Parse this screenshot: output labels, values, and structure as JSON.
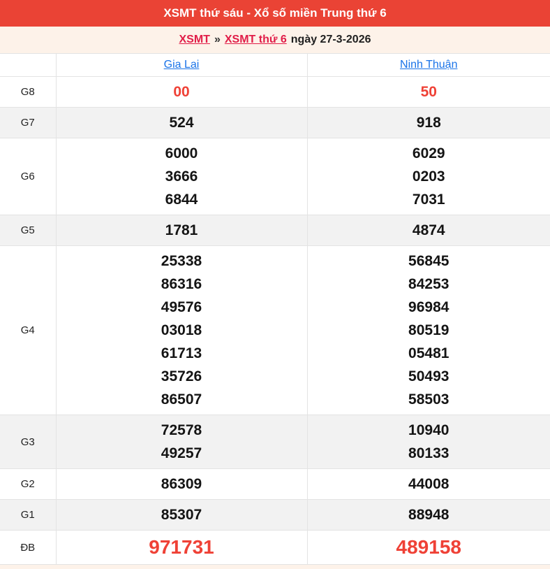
{
  "header": {
    "title": "XSMT thứ sáu - Xổ số miền Trung thứ 6"
  },
  "breadcrumb": {
    "link1": "XSMT",
    "separator": "»",
    "link2": "XSMT thứ 6",
    "suffix": "ngày 27-3-2026"
  },
  "columns": [
    "Gia Lai",
    "Ninh Thuận"
  ],
  "rows": [
    {
      "label": "G8",
      "highlight": true,
      "shaded": false,
      "big": false,
      "cells": [
        [
          "00"
        ],
        [
          "50"
        ]
      ]
    },
    {
      "label": "G7",
      "highlight": false,
      "shaded": true,
      "big": false,
      "cells": [
        [
          "524"
        ],
        [
          "918"
        ]
      ]
    },
    {
      "label": "G6",
      "highlight": false,
      "shaded": false,
      "big": false,
      "cells": [
        [
          "6000",
          "3666",
          "6844"
        ],
        [
          "6029",
          "0203",
          "7031"
        ]
      ]
    },
    {
      "label": "G5",
      "highlight": false,
      "shaded": true,
      "big": false,
      "cells": [
        [
          "1781"
        ],
        [
          "4874"
        ]
      ]
    },
    {
      "label": "G4",
      "highlight": false,
      "shaded": false,
      "big": false,
      "cells": [
        [
          "25338",
          "86316",
          "49576",
          "03018",
          "61713",
          "35726",
          "86507"
        ],
        [
          "56845",
          "84253",
          "96984",
          "80519",
          "05481",
          "50493",
          "58503"
        ]
      ]
    },
    {
      "label": "G3",
      "highlight": false,
      "shaded": true,
      "big": false,
      "cells": [
        [
          "72578",
          "49257"
        ],
        [
          "10940",
          "80133"
        ]
      ]
    },
    {
      "label": "G2",
      "highlight": false,
      "shaded": false,
      "big": false,
      "cells": [
        [
          "86309"
        ],
        [
          "44008"
        ]
      ]
    },
    {
      "label": "G1",
      "highlight": false,
      "shaded": true,
      "big": false,
      "cells": [
        [
          "85307"
        ],
        [
          "88948"
        ]
      ]
    },
    {
      "label": "ĐB",
      "highlight": true,
      "shaded": false,
      "big": true,
      "cells": [
        [
          "971731"
        ],
        [
          "489158"
        ]
      ]
    }
  ],
  "colors": {
    "header_bar": "#ea4335",
    "highlight_number": "#ef4136",
    "breadcrumb_link": "#e11d48",
    "column_link": "#1a73e8",
    "shaded_row": "#f2f2f2",
    "border": "#e3e3e3",
    "page_background": "#fdf2e9"
  }
}
